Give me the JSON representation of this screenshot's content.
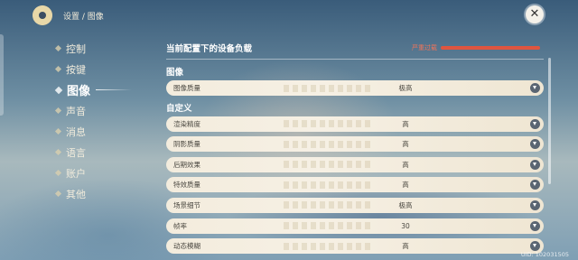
{
  "header": {
    "breadcrumb": "设置 / 图像",
    "close_icon": "close-icon"
  },
  "sidebar": {
    "items": [
      {
        "label": "控制",
        "active": false
      },
      {
        "label": "按键",
        "active": false
      },
      {
        "label": "图像",
        "active": true
      },
      {
        "label": "声音",
        "active": false
      },
      {
        "label": "消息",
        "active": false
      },
      {
        "label": "语言",
        "active": false
      },
      {
        "label": "账户",
        "active": false
      },
      {
        "label": "其他",
        "active": false
      }
    ]
  },
  "panel": {
    "load_title": "当前配置下的设备负载",
    "load_status": "严重过载",
    "load_color": "#e0553f",
    "section_image": "图像",
    "section_custom": "自定义",
    "image_quality": {
      "label": "图像质量",
      "value": "极高"
    },
    "custom": [
      {
        "label": "渲染精度",
        "value": "高"
      },
      {
        "label": "阴影质量",
        "value": "高"
      },
      {
        "label": "后期效果",
        "value": "高"
      },
      {
        "label": "特效质量",
        "value": "高"
      },
      {
        "label": "场景细节",
        "value": "极高"
      },
      {
        "label": "帧率",
        "value": "30"
      },
      {
        "label": "动态模糊",
        "value": "高"
      }
    ]
  },
  "footer": {
    "uid": "UID: 102031505"
  }
}
